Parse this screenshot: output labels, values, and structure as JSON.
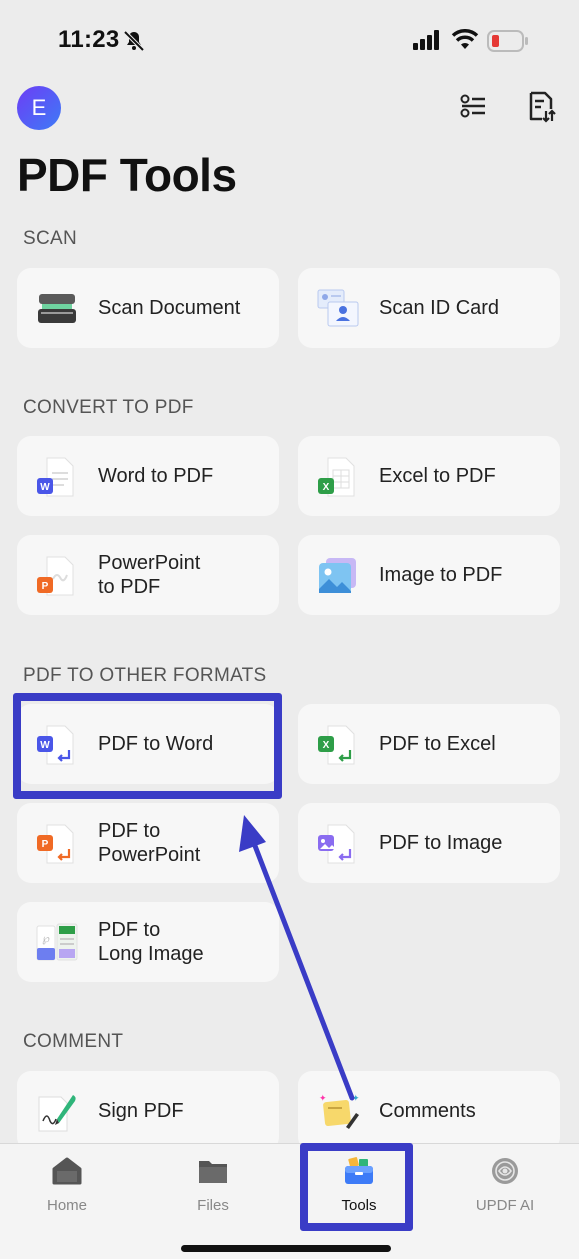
{
  "status": {
    "time": "11:23"
  },
  "header": {
    "avatar_letter": "E",
    "title": "PDF Tools"
  },
  "sections": {
    "scan": "SCAN",
    "convert_to_pdf": "CONVERT TO PDF",
    "pdf_to_other": "PDF TO OTHER FORMATS",
    "comment": "COMMENT"
  },
  "tools": {
    "scan_document": "Scan Document",
    "scan_id_card": "Scan ID Card",
    "word_to_pdf": "Word to PDF",
    "excel_to_pdf": "Excel to PDF",
    "powerpoint_to_pdf": [
      "PowerPoint",
      "to PDF"
    ],
    "image_to_pdf": "Image to PDF",
    "pdf_to_word": "PDF to Word",
    "pdf_to_excel": "PDF to Excel",
    "pdf_to_powerpoint": [
      "PDF to",
      "PowerPoint"
    ],
    "pdf_to_image": "PDF to Image",
    "pdf_to_long_image": [
      "PDF to",
      "Long Image"
    ],
    "sign_pdf": "Sign PDF",
    "comments": "Comments"
  },
  "tabbar": {
    "home": "Home",
    "files": "Files",
    "tools": "Tools",
    "ai": "UPDF AI"
  },
  "colors": {
    "accent": "#3a3cc6",
    "word": "#4a56e8",
    "excel": "#2e9e48",
    "powerpoint": "#f06a25"
  }
}
